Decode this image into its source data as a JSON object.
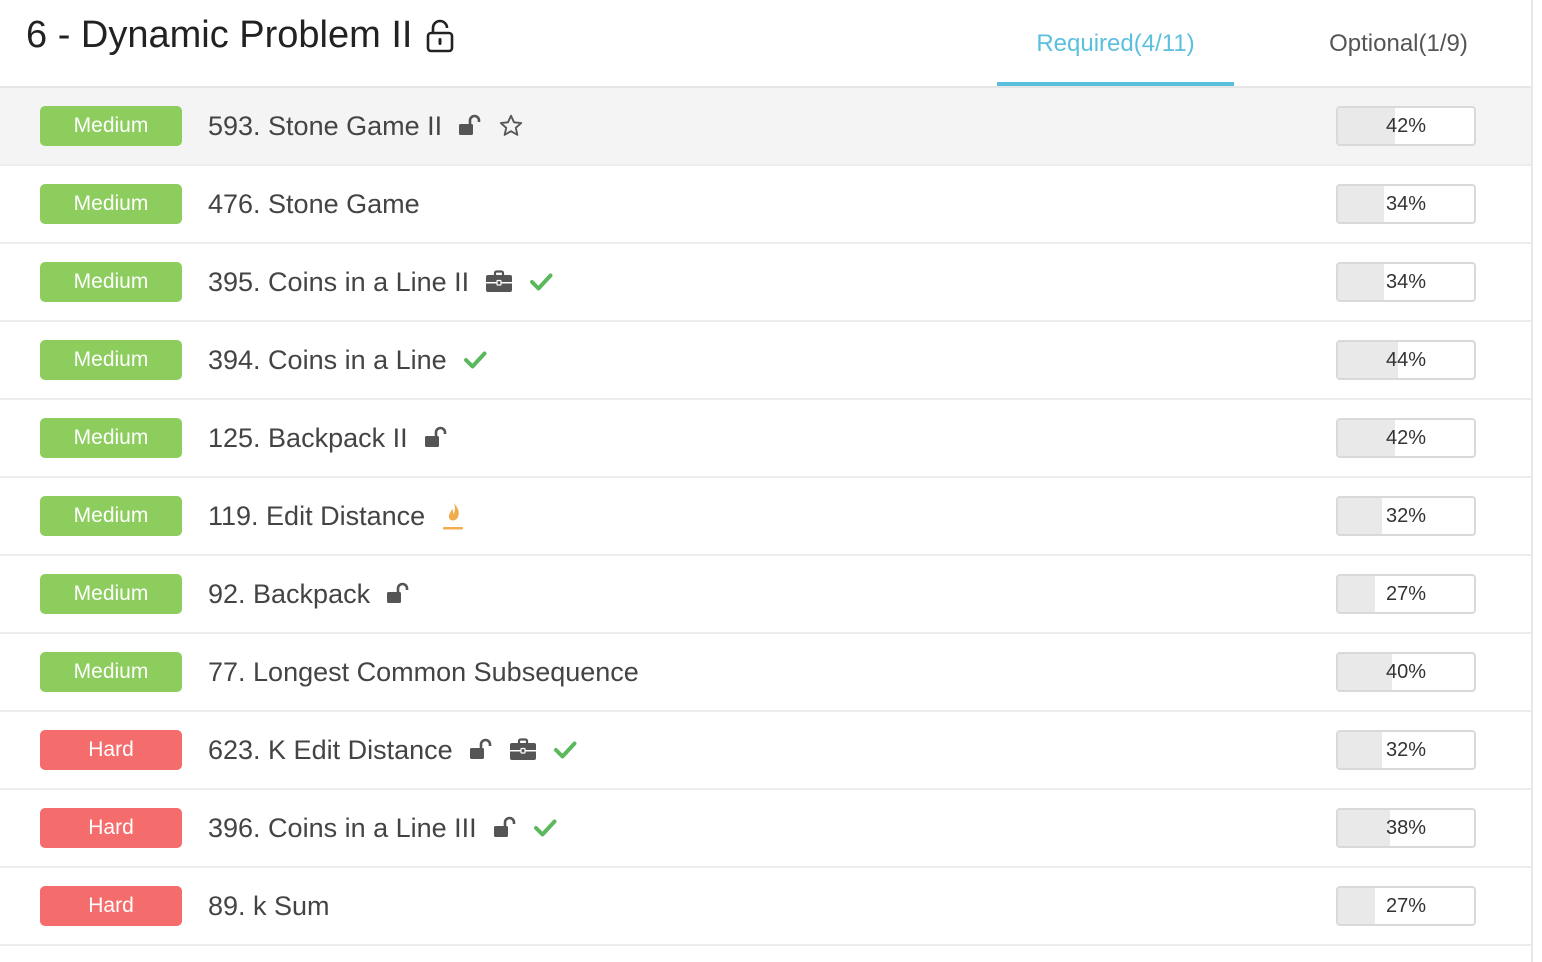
{
  "header": {
    "title": "6 - Dynamic Problem II",
    "tabs": [
      {
        "label": "Required(4/11)",
        "active": true
      },
      {
        "label": "Optional(1/9)",
        "active": false
      }
    ]
  },
  "colors": {
    "accent": "#5bc0de",
    "medium": "#8ccd5e",
    "hard": "#f56c6c",
    "check": "#5cb85c",
    "hot": "#f0ad4e"
  },
  "problems": [
    {
      "difficulty": "Medium",
      "name": "593. Stone Game II",
      "icons": [
        "unlock-icon",
        "star-icon"
      ],
      "rate": "42%",
      "rate_value": 42
    },
    {
      "difficulty": "Medium",
      "name": "476. Stone Game",
      "icons": [],
      "rate": "34%",
      "rate_value": 34
    },
    {
      "difficulty": "Medium",
      "name": "395. Coins in a Line II",
      "icons": [
        "briefcase-icon",
        "check-icon"
      ],
      "rate": "34%",
      "rate_value": 34
    },
    {
      "difficulty": "Medium",
      "name": "394. Coins in a Line",
      "icons": [
        "check-icon"
      ],
      "rate": "44%",
      "rate_value": 44
    },
    {
      "difficulty": "Medium",
      "name": "125. Backpack II",
      "icons": [
        "unlock-icon"
      ],
      "rate": "42%",
      "rate_value": 42
    },
    {
      "difficulty": "Medium",
      "name": "119. Edit Distance",
      "icons": [
        "fire-icon"
      ],
      "rate": "32%",
      "rate_value": 32
    },
    {
      "difficulty": "Medium",
      "name": "92. Backpack",
      "icons": [
        "unlock-icon"
      ],
      "rate": "27%",
      "rate_value": 27
    },
    {
      "difficulty": "Medium",
      "name": "77. Longest Common Subsequence",
      "icons": [],
      "rate": "40%",
      "rate_value": 40
    },
    {
      "difficulty": "Hard",
      "name": "623. K Edit Distance",
      "icons": [
        "unlock-icon",
        "briefcase-icon",
        "check-icon"
      ],
      "rate": "32%",
      "rate_value": 32
    },
    {
      "difficulty": "Hard",
      "name": "396. Coins in a Line III",
      "icons": [
        "unlock-icon",
        "check-icon"
      ],
      "rate": "38%",
      "rate_value": 38
    },
    {
      "difficulty": "Hard",
      "name": "89. k Sum",
      "icons": [],
      "rate": "27%",
      "rate_value": 27
    }
  ]
}
